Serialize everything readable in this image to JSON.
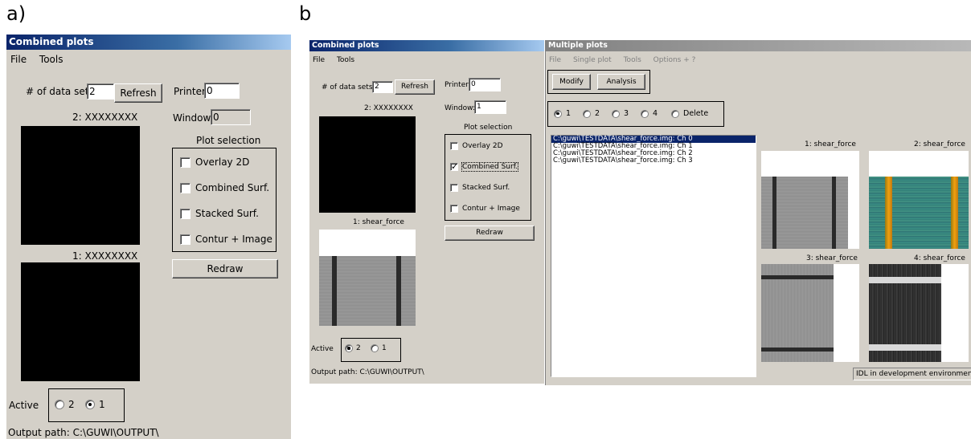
{
  "labels": {
    "a": "a)",
    "b": "b"
  },
  "panel_a": {
    "title": "Combined plots",
    "menu": [
      "File",
      "Tools"
    ],
    "datasets_label": "# of data sets",
    "datasets_value": "2",
    "refresh": "Refresh",
    "printer_label": "Printer:",
    "printer_value": "0",
    "window_label": "Window:",
    "window_value": "0",
    "plot2_label": "2: XXXXXXXX",
    "plot1_label": "1: XXXXXXXX",
    "plot_selection": "Plot selection",
    "options": [
      {
        "label": "Overlay 2D",
        "checked": false
      },
      {
        "label": "Combined Surf.",
        "checked": false
      },
      {
        "label": "Stacked Surf.",
        "checked": false
      },
      {
        "label": "Contur + Image",
        "checked": false
      }
    ],
    "redraw": "Redraw",
    "active_label": "Active",
    "active_options": [
      "2",
      "1"
    ],
    "active_selected": "1",
    "output_path": "Output path: C:\\GUWI\\OUTPUT\\"
  },
  "panel_b_left": {
    "title": "Combined plots",
    "menu": [
      "File",
      "Tools"
    ],
    "datasets_label": "# of data sets",
    "datasets_value": "2",
    "refresh": "Refresh",
    "printer_label": "Printer:",
    "printer_value": "0",
    "window_label": "Window:",
    "window_value": "1",
    "plot2_label": "2: XXXXXXXX",
    "plot1_label": "1: shear_force",
    "plot_selection": "Plot selection",
    "options": [
      {
        "label": "Overlay 2D",
        "checked": false
      },
      {
        "label": "Combined Surf.",
        "checked": true
      },
      {
        "label": "Stacked Surf.",
        "checked": false
      },
      {
        "label": "Contur + Image",
        "checked": false
      }
    ],
    "redraw": "Redraw",
    "active_label": "Active",
    "active_options": [
      "2",
      "1"
    ],
    "active_selected": "2",
    "output_path": "Output path: C:\\GUWI\\OUTPUT\\"
  },
  "panel_b_right": {
    "title": "Multiple plots",
    "menu": [
      "File",
      "Single plot",
      "Tools",
      "Options + ?"
    ],
    "modify": "Modify",
    "analysis": "Analysis",
    "radio_options": [
      "1",
      "2",
      "3",
      "4",
      "Delete"
    ],
    "radio_selected": "1",
    "files": [
      "C:\\guwi\\TESTDATA\\shear_force.img: Ch 0",
      "C:\\guwi\\TESTDATA\\shear_force.img: Ch 1",
      "C:\\guwi\\TESTDATA\\shear_force.img: Ch 2",
      "C:\\guwi\\TESTDATA\\shear_force.img: Ch 3"
    ],
    "selected_file_index": 0,
    "plot_titles": [
      "1: shear_force",
      "2: shear_force",
      "3: shear_force",
      "4: shear_force"
    ],
    "status": "IDL in development environment"
  },
  "colors": {
    "window_bg": "#d4d0c8",
    "title_start": "#0a246a",
    "title_end": "#a6caf0",
    "selection": "#0a246a",
    "heatmap_bg": "#3a8a7a",
    "heatmap_stripe": "#e08a10"
  }
}
